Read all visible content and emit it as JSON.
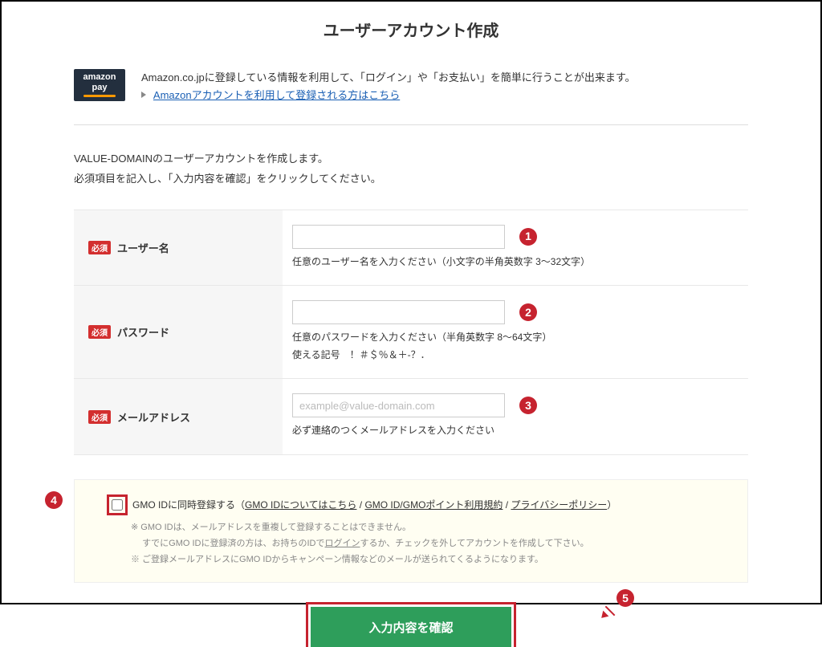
{
  "page_title": "ユーザーアカウント作成",
  "amazon": {
    "logo_line1": "amazon",
    "logo_line2": "pay",
    "text": "Amazon.co.jpに登録している情報を利用して、「ログイン」や「お支払い」を簡単に行うことが出来ます。",
    "link_text": "Amazonアカウントを利用して登録される方はこちら"
  },
  "intro": {
    "line1": "VALUE-DOMAINのユーザーアカウントを作成します。",
    "line2": "必須項目を記入し、「入力内容を確認」をクリックしてください。"
  },
  "required_label": "必須",
  "fields": {
    "username": {
      "label": "ユーザー名",
      "hint": "任意のユーザー名を入力ください（小文字の半角英数字 3〜32文字）",
      "marker": "1"
    },
    "password": {
      "label": "パスワード",
      "hint1": "任意のパスワードを入力ください（半角英数字 8〜64文字）",
      "hint2": "使える記号　！＃＄％＆＋‐？．",
      "marker": "2"
    },
    "email": {
      "label": "メールアドレス",
      "placeholder": "example@value-domain.com",
      "hint": "必ず連絡のつくメールアドレスを入力ください",
      "marker": "3"
    }
  },
  "gmo": {
    "marker": "4",
    "checkbox_label": "GMO IDに同時登録する",
    "link1": "GMO IDについてはこちら",
    "link2": "GMO ID/GMOポイント利用規約",
    "link3": "プライバシーポリシー",
    "open_paren": "（",
    "sep": " / ",
    "close_paren": "）",
    "note1": "※ GMO IDは、メールアドレスを重複して登録することはできません。",
    "note2_pre": "すでにGMO IDに登録済の方は、お持ちのIDで",
    "note2_link": "ログイン",
    "note2_post": "するか、チェックを外してアカウントを作成して下さい。",
    "note3": "※ ご登録メールアドレスにGMO IDからキャンペーン情報などのメールが送られてくるようになります。"
  },
  "submit": {
    "label": "入力内容を確認",
    "marker": "5"
  }
}
